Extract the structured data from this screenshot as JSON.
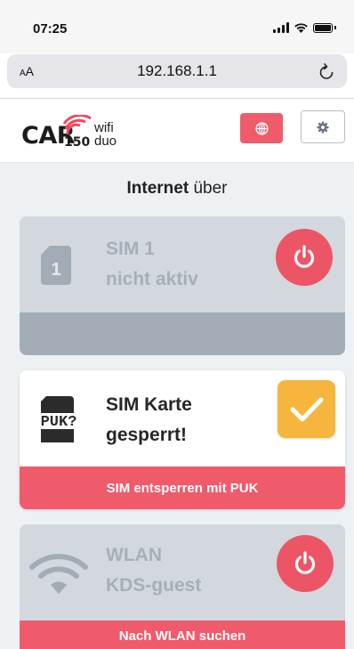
{
  "status_bar": {
    "time": "07:25",
    "icons": [
      "signal-icon",
      "wifi-icon",
      "battery-icon"
    ]
  },
  "browser": {
    "text_size_label_small": "A",
    "text_size_label_large": "A",
    "url": "192.168.1.1",
    "reload_icon": "reload-icon"
  },
  "header": {
    "logo": {
      "brand": "CAR",
      "model": "150",
      "line1": "wifi",
      "line2": "duo"
    },
    "globe_icon": "globe-icon",
    "gear_icon": "gear-icon",
    "accent_color": "#ef5b6b"
  },
  "main": {
    "heading_bold": "Internet",
    "heading_rest": "über",
    "cards": [
      {
        "icon": "sim-card-icon",
        "icon_label": "1",
        "title_line1": "SIM 1",
        "title_line2": "nicht aktiv",
        "status": "inactive",
        "action_icon": "power-icon",
        "footer_label": ""
      },
      {
        "icon": "sim-card-puk-icon",
        "icon_label": "PUK?",
        "title_line1": "SIM Karte",
        "title_line2": "gesperrt!",
        "status": "locked",
        "action_icon": "check-icon",
        "footer_label": "SIM entsperren mit PUK"
      },
      {
        "icon": "wifi-icon",
        "title_line1": "WLAN",
        "title_line2": "KDS-guest",
        "status": "inactive",
        "action_icon": "power-icon",
        "footer_label": "Nach WLAN suchen"
      }
    ]
  }
}
